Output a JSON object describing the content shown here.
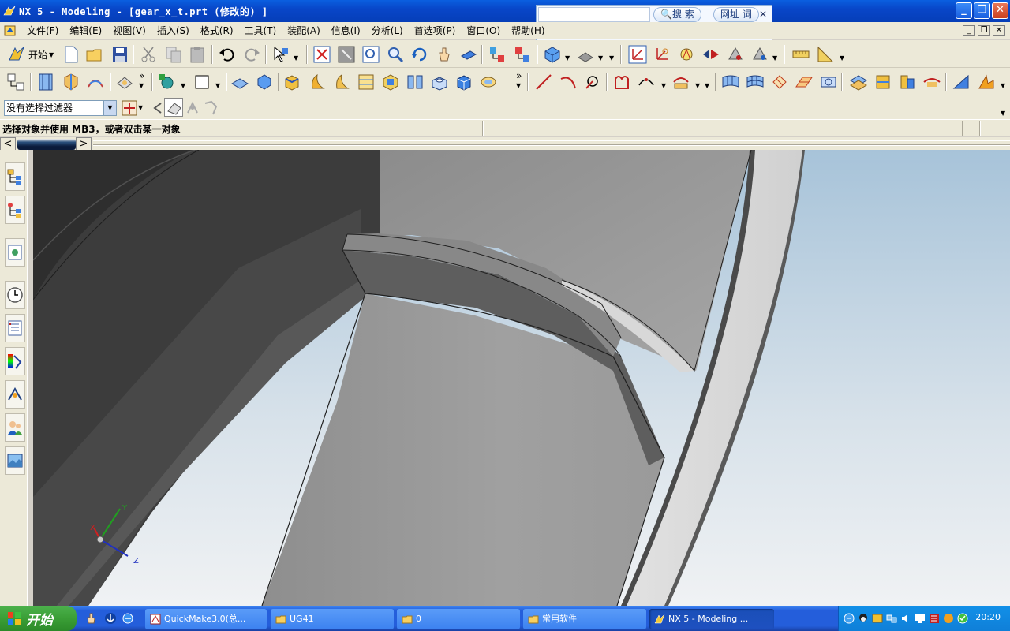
{
  "window": {
    "title": "NX 5 - Modeling - [gear_x_t.prt  (修改的) ]"
  },
  "searchbar": {
    "search_label": "搜 索",
    "url_label": "网址",
    "word_label": "词"
  },
  "menu": {
    "items": [
      "文件(F)",
      "编辑(E)",
      "视图(V)",
      "插入(S)",
      "格式(R)",
      "工具(T)",
      "装配(A)",
      "信息(I)",
      "分析(L)",
      "首选项(P)",
      "窗口(O)",
      "帮助(H)"
    ]
  },
  "toolbar": {
    "start_label": "开始",
    "filter_value": "没有选择过滤器"
  },
  "cue": {
    "text": "选择对象并使用 MB3，或者双击某一对象"
  },
  "triad": {
    "x_label": "X",
    "y_label": "Y",
    "z_label": "Z"
  },
  "taskbar": {
    "start_label": "开始",
    "tasks": [
      {
        "label": "QuickMake3.0(总..."
      },
      {
        "label": "UG41"
      },
      {
        "label": "0"
      },
      {
        "label": "常用软件"
      },
      {
        "label": "NX 5 - Modeling ..."
      }
    ],
    "clock": "20:20"
  },
  "colors": {
    "title_blue": "#0846c8",
    "taskbar_blue": "#245edb",
    "start_green": "#3a9e36",
    "bg_light": "#ece9d8"
  }
}
